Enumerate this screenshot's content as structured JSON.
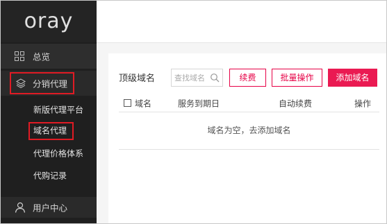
{
  "sidebar": {
    "logo": "oray",
    "items": [
      {
        "label": "总览",
        "icon": "grid-icon"
      },
      {
        "label": "分销代理",
        "icon": "layers-icon"
      }
    ],
    "subitems": [
      "新版代理平台",
      "域名代理",
      "代理价格体系",
      "代购记录"
    ],
    "user": {
      "label": "用户中心",
      "icon": "user-icon"
    }
  },
  "main": {
    "title": "顶级域名",
    "search_placeholder": "查找域名",
    "buttons": {
      "renew": "续费",
      "batch": "批量操作",
      "add": "添加域名"
    },
    "table": {
      "columns": [
        "域名",
        "服务到期日",
        "自动续费",
        "操作"
      ],
      "empty_text": "域名为空，去添加域名"
    }
  },
  "colors": {
    "accent": "#ea1a52",
    "highlight_box": "#e01b24",
    "sidebar_bg": "#1f1f1f"
  }
}
